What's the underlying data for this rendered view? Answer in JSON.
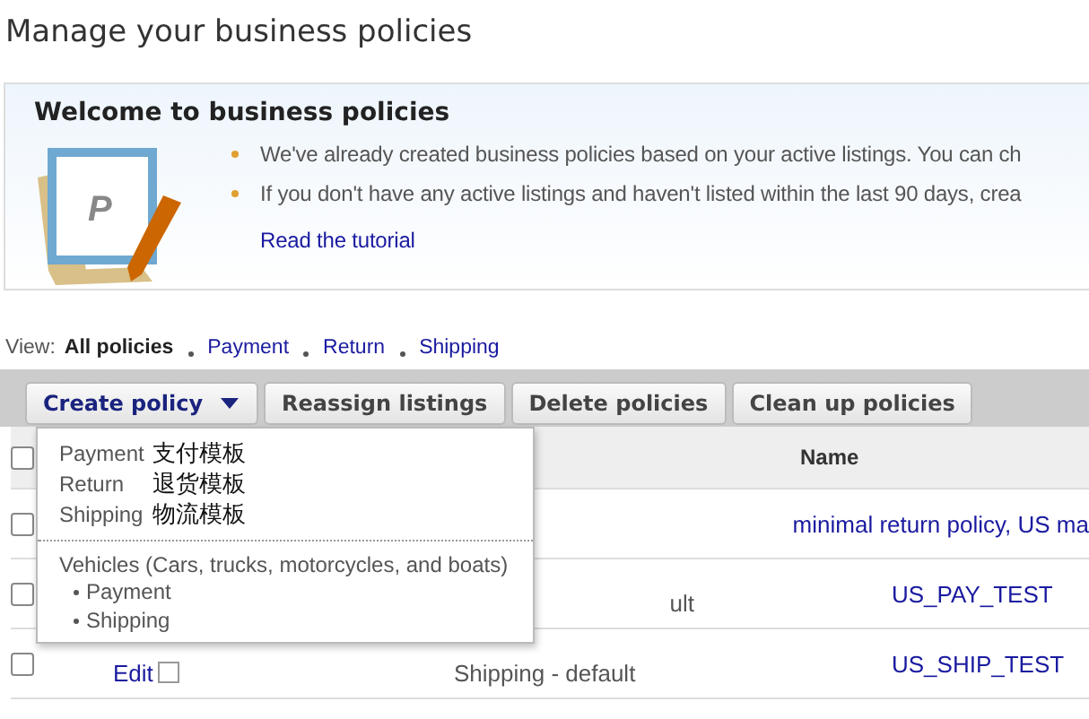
{
  "page_title": "Manage your business policies",
  "welcome": {
    "title": "Welcome to business policies",
    "logo_letter": "P",
    "bullets": [
      "We've already created business policies based on your active listings. You can ch",
      "If you don't have any active listings and haven't listed within the last 90 days, crea"
    ],
    "link": "Read the tutorial"
  },
  "view_filter": {
    "label": "View:",
    "options": [
      {
        "label": "All policies",
        "selected": true
      },
      {
        "label": "Payment",
        "selected": false
      },
      {
        "label": "Return",
        "selected": false
      },
      {
        "label": "Shipping",
        "selected": false
      }
    ]
  },
  "toolbar": {
    "create_button": "Create policy",
    "buttons": [
      "Reassign listings",
      "Delete policies",
      "Clean up policies"
    ]
  },
  "create_menu": {
    "items": [
      {
        "label": "Payment",
        "note": "支付模板"
      },
      {
        "label": "Return",
        "note": "退货模板"
      },
      {
        "label": "Shipping",
        "note": "物流模板"
      }
    ],
    "group": {
      "title": "Vehicles (Cars, trucks, motorcycles, and boats)",
      "items": [
        "Payment",
        "Shipping"
      ]
    }
  },
  "table": {
    "columns": [
      "Name"
    ],
    "select_all_checked": false,
    "rows": [
      {
        "checked": false,
        "action": "",
        "type": "",
        "name": "minimal return policy, US ma"
      },
      {
        "checked": false,
        "action": "",
        "type": "ult",
        "name": "US_PAY_TEST"
      },
      {
        "checked": false,
        "action": "Edit",
        "action_checked": false,
        "type": "Shipping - default",
        "name": "US_SHIP_TEST"
      }
    ]
  }
}
